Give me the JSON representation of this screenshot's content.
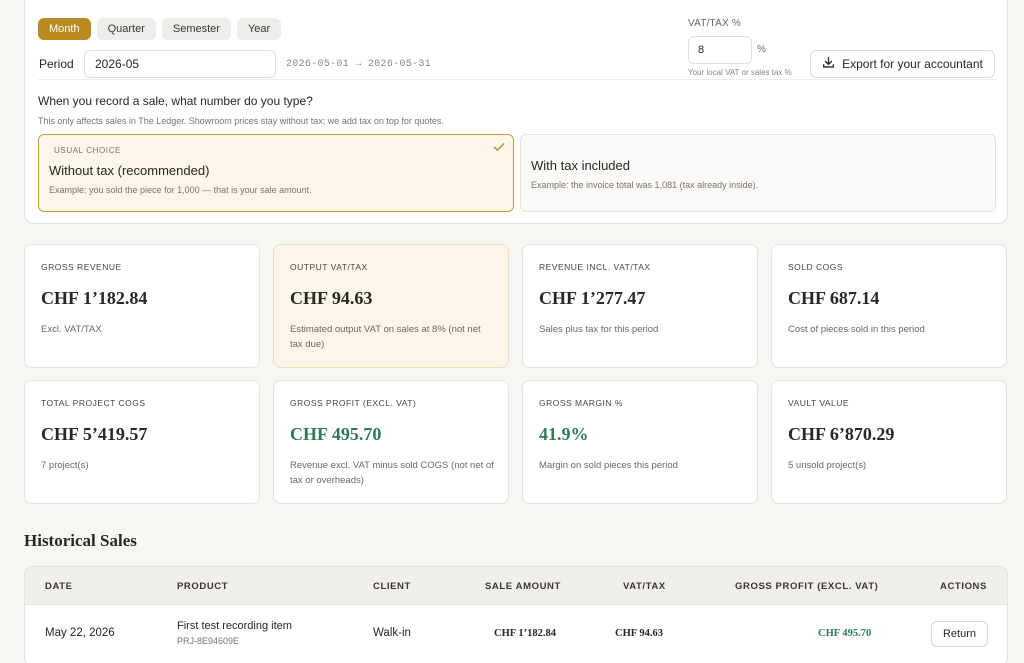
{
  "period_tabs": [
    "Month",
    "Quarter",
    "Semester",
    "Year"
  ],
  "period": {
    "label": "Period",
    "value": "2026-05",
    "range": "2026-05-01 → 2026-05-31"
  },
  "vat": {
    "label": "VAT/TAX %",
    "value": "8",
    "percent_sign": "%",
    "hint": "Your local VAT or sales tax %"
  },
  "export_label": "Export for your accountant",
  "entry_mode": {
    "question": "When you record a sale, what number do you type?",
    "subtitle": "This only affects sales in The Ledger. Showroom prices stay without tax; we add tax on top for quotes.",
    "option_a": {
      "tag": "USUAL CHOICE",
      "title": "Without tax (recommended)",
      "desc": "Example: you sold the piece for 1,000 — that is your sale amount."
    },
    "option_b": {
      "title": "With tax included",
      "desc": "Example: the invoice total was 1,081 (tax already inside)."
    }
  },
  "stats": [
    {
      "label": "GROSS REVENUE",
      "value": "CHF 1’182.84",
      "note": "Excl. VAT/TAX"
    },
    {
      "label": "OUTPUT VAT/TAX",
      "value": "CHF 94.63",
      "note": "Estimated output VAT on sales at 8% (not net tax due)"
    },
    {
      "label": "REVENUE INCL. VAT/TAX",
      "value": "CHF 1’277.47",
      "note": "Sales plus tax for this period"
    },
    {
      "label": "SOLD COGS",
      "value": "CHF 687.14",
      "note": "Cost of pieces sold in this period"
    },
    {
      "label": "TOTAL PROJECT COGS",
      "value": "CHF 5’419.57",
      "note": "7 project(s)"
    },
    {
      "label": "GROSS PROFIT (EXCL. VAT)",
      "value": "CHF 495.70",
      "note": "Revenue excl. VAT minus sold COGS (not net of tax or overheads)"
    },
    {
      "label": "GROSS MARGIN %",
      "value": "41.9%",
      "note": "Margin on sold pieces this period"
    },
    {
      "label": "VAULT VALUE",
      "value": "CHF 6’870.29",
      "note": "5 unsold project(s)"
    }
  ],
  "history": {
    "title": "Historical Sales",
    "columns": [
      "DATE",
      "PRODUCT",
      "CLIENT",
      "SALE AMOUNT",
      "VAT/TAX",
      "GROSS PROFIT (EXCL. VAT)",
      "ACTIONS"
    ],
    "rows": [
      {
        "date": "May 22, 2026",
        "product": "First test recording item",
        "product_id": "PRJ-8E94609E",
        "client": "Walk-in",
        "sale_amount": "CHF 1’182.84",
        "vat": "CHF 94.63",
        "gross_profit": "CHF 495.70",
        "action": "Return"
      }
    ]
  },
  "colors": {
    "accent": "#b88a1f",
    "positive": "#2d7a54",
    "highlight_bg": "#fcf6ea"
  }
}
